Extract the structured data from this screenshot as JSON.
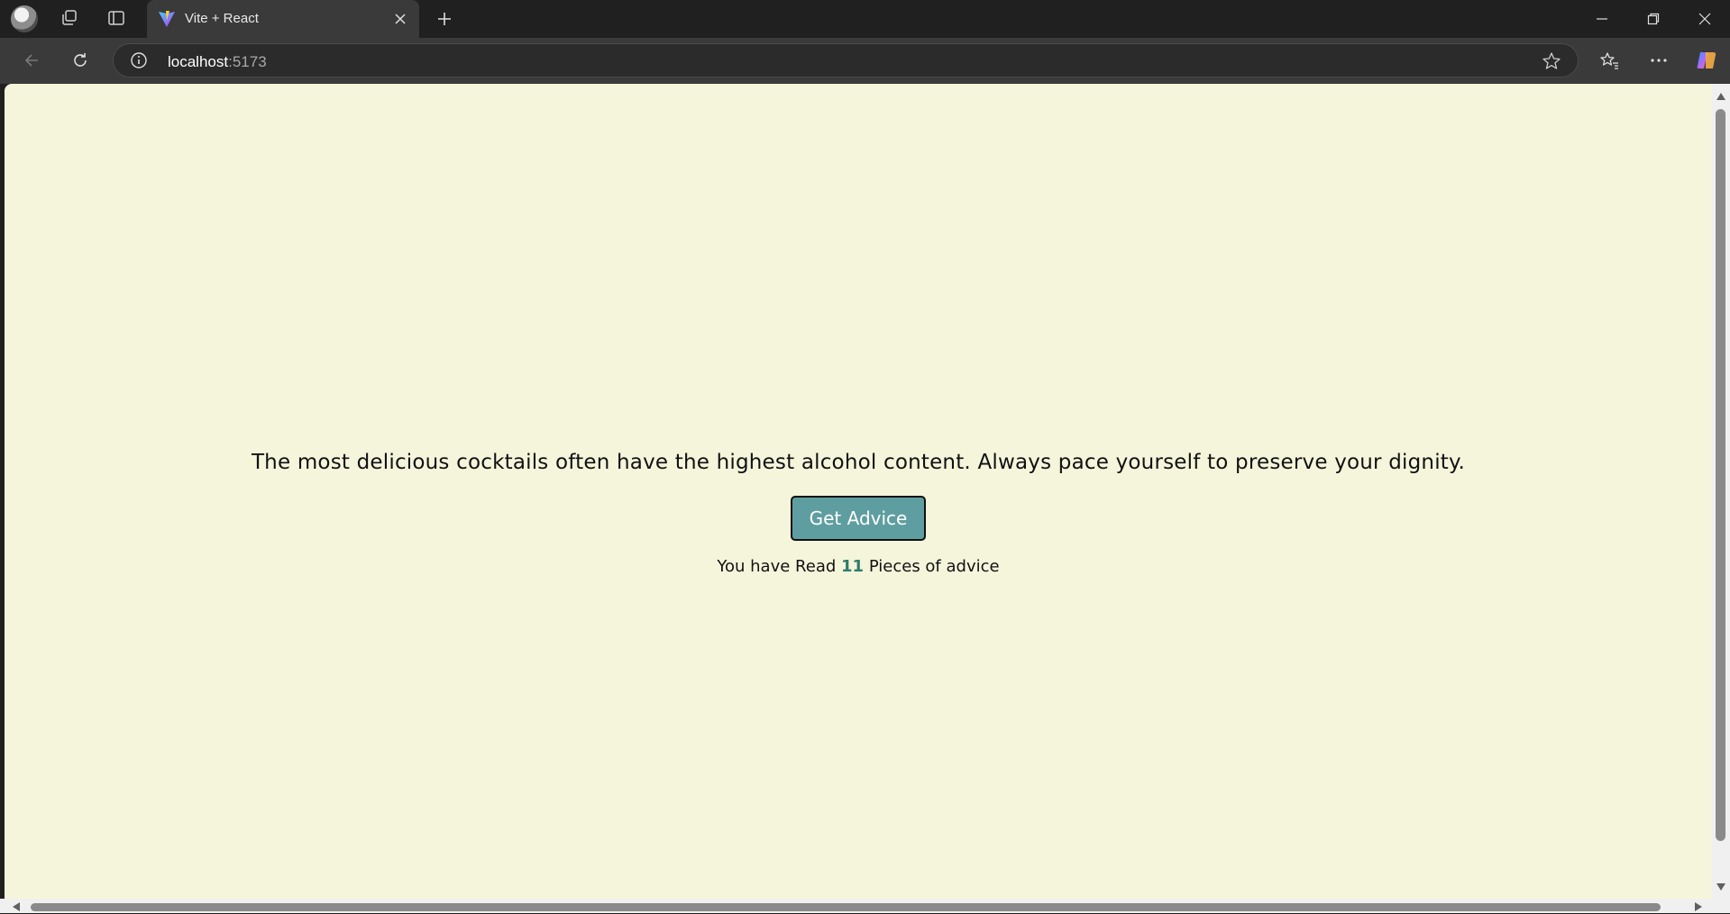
{
  "browser": {
    "tab": {
      "title": "Vite + React"
    },
    "address": {
      "host": "localhost",
      "port": ":5173"
    }
  },
  "page": {
    "advice": "The most delicious cocktails often have the highest alcohol content. Always pace yourself to preserve your dignity.",
    "button_label": "Get Advice",
    "counter": {
      "prefix": "You have Read",
      "count": "11",
      "suffix": "Pieces of advice"
    }
  },
  "colors": {
    "page_background": "#f5f5dc",
    "button_background": "#5f9ea0",
    "count_color": "#2e7d6b",
    "browser_chrome": "#202020"
  }
}
